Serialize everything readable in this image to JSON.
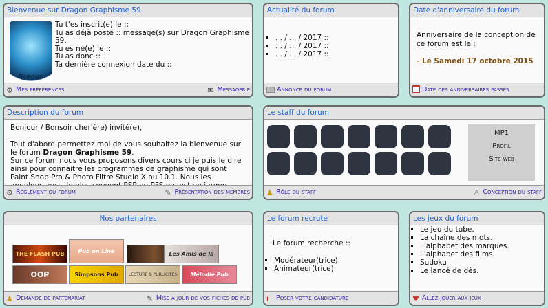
{
  "welcome": {
    "title": "Bienvenue sur Dragon Graphisme 59",
    "avatar_text": "Dragon",
    "lines": [
      "Tu t'es inscrit(e) le ::",
      "Tu as déjà posté :: message(s) sur Dragon Graphisme 59.",
      "Tu es né(e) le ::",
      "Tu as donc ::",
      "Ta dernière connexion date du ::"
    ],
    "footer_left": "Mes préférences",
    "footer_right": "Messagerie"
  },
  "news": {
    "title": "Actualité du forum",
    "items": [
      ". . / . . / 2017 ::",
      ". . / . . / 2017 ::",
      ". . / . . / 2017 ::"
    ],
    "footer": "Annonce du forum"
  },
  "anniversary": {
    "title": "Date d'anniversaire du forum",
    "text": "Anniversaire de la conception de ce forum est le :",
    "date": "- Le Samedi 17 octobre 2015",
    "footer": "Date des anniversaires passés"
  },
  "description": {
    "title": "Description du forum",
    "greeting": "Bonjour / Bonsoir cher'ère) invité(e),",
    "intro": "Tout d'abord permettez moi de vous souhaitez la bienvenue sur le forum",
    "forum_name": "Dragon Graphisme 59",
    "body": "Sur ce forum nous vous proposons divers cours ci je puis le dire ainsi pour connaitre les programmes de graphisme qui sont Paint Shop Pro & Photo Filtre Studio X ou 10.1. Nous les appelons aussi le plus souvent PSP ou PFS qui est un jargon commun de graphisme que nous",
    "footer_left": "Règlement du forum",
    "footer_right": "Présentation des membres"
  },
  "staff": {
    "title": "Le staff du forum",
    "box": [
      "MP1",
      "Profil",
      "Site web"
    ],
    "footer_left": "Rôle du staff",
    "footer_right": "Conception du staff"
  },
  "partners": {
    "title": "Nos partenaires",
    "banners": [
      "THE FLASH PUB",
      "Pub on Line",
      "",
      "Les Amis de la pub",
      "OOP",
      "Simpsons Pub",
      "LECTURE & PUBLICITES",
      "Mélodie Pub"
    ],
    "footer_left": "Demande de partenariat",
    "footer_right": "Mise à jour de vos fiches de pub"
  },
  "recruit": {
    "title": "Le forum recrute",
    "intro": "Le forum recherche ::",
    "items": [
      "Modérateur(trice)",
      "Animateur(trice)"
    ],
    "footer": "Poser votre candidature"
  },
  "games": {
    "title": "Les jeux du forum",
    "items": [
      "Le jeu du tube.",
      "La chaîne des mots.",
      "L'alphabet des marques.",
      "L'alphabet des films.",
      "Sudoku",
      "Le lancé de dés."
    ],
    "footer": "Allez jouer aux jeux"
  }
}
